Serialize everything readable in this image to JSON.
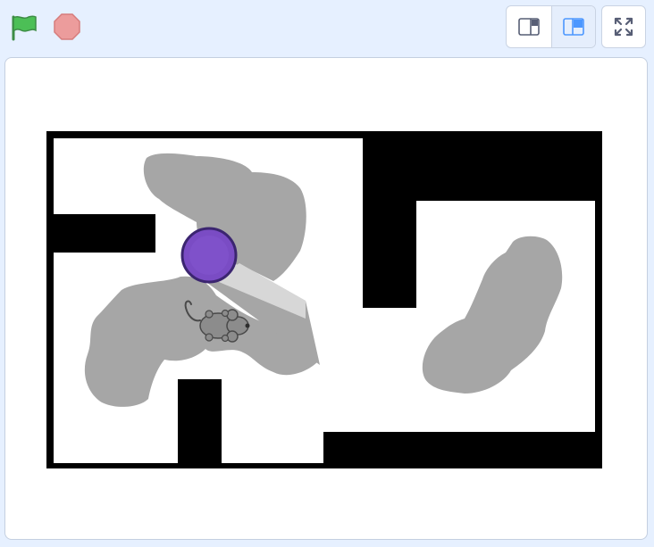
{
  "toolbar": {
    "green_flag": {
      "icon": "green-flag-icon",
      "color": "#4cbf56"
    },
    "stop": {
      "icon": "stop-sign-icon",
      "color": "#ec9c9c"
    },
    "small_stage": {
      "icon": "small-stage-layout-icon",
      "active": false
    },
    "normal_stage": {
      "icon": "normal-stage-layout-icon",
      "active": true,
      "accent": "#4c97ff"
    },
    "fullscreen": {
      "icon": "fullscreen-icon"
    }
  },
  "stage": {
    "background": "#ffffff",
    "maze": {
      "wall_color": "#000000",
      "floor_color": "#ffffff"
    },
    "fog": {
      "color": "#a6a6a6"
    },
    "player": {
      "name": "purple-ball",
      "color": "#7a4cc4",
      "outline": "#3b2570"
    },
    "mouse": {
      "name": "mouse-sprite",
      "color": "#8c8c8c"
    }
  }
}
